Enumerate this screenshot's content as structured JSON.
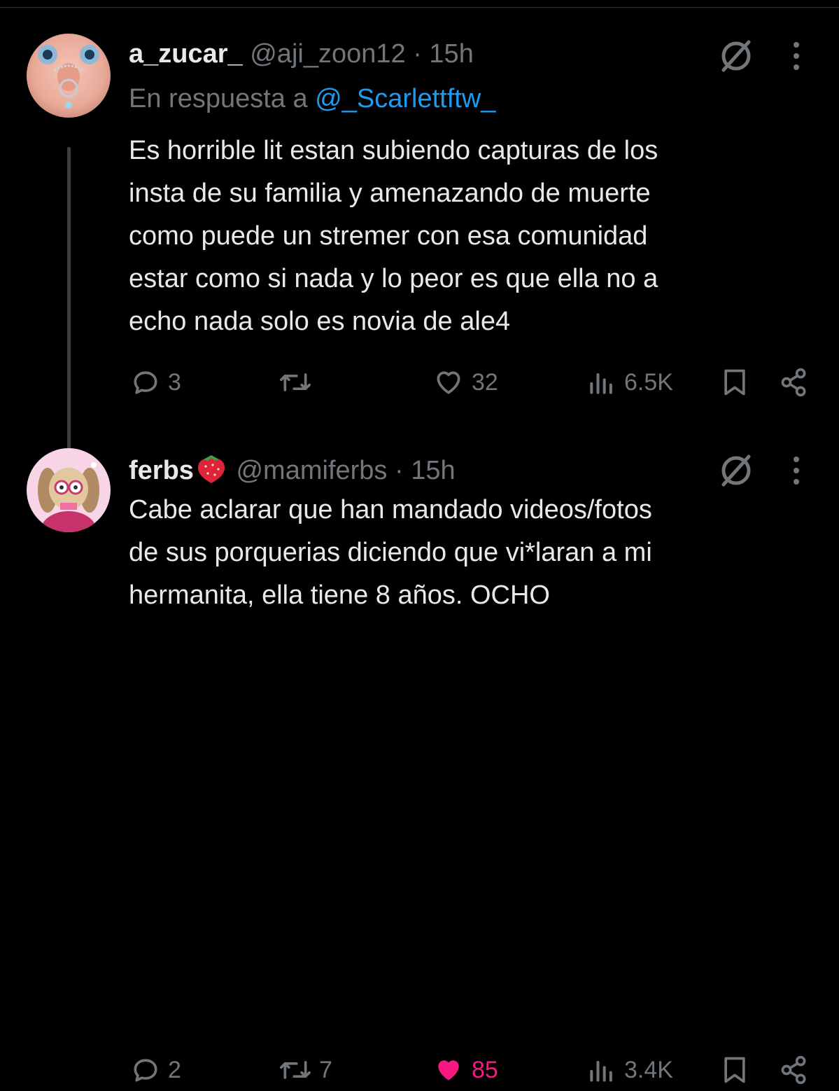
{
  "tweets": [
    {
      "author_name": "a_zucar_",
      "handle": "@aji_zoon12",
      "separator": "·",
      "time": "15h",
      "reply_prefix": "En respuesta a",
      "reply_mention": "@_Scarlettftw_",
      "text": "Es horrible lit estan subiendo capturas de los\ninsta de su familia y amenazando de muerte\ncomo puede un stremer con esa comunidad\nestar como si nada y lo peor es que ella no a\necho nada solo es novia de ale4",
      "replies": "3",
      "retweets": "",
      "likes": "32",
      "liked": false,
      "views": "6.5K"
    },
    {
      "author_name": "ferbs",
      "handle": "@mamiferbs",
      "separator": "·",
      "time": "15h",
      "text": "Cabe aclarar que han mandado videos/fotos\nde sus porquerias diciendo que vi*laran a mi\nhermanita, ella tiene 8 años. OCHO",
      "replies": "2",
      "retweets": "7",
      "likes": "85",
      "liked": true,
      "views": "3.4K"
    }
  ],
  "colors": {
    "background": "#000000",
    "text": "#e7e9ea",
    "muted": "#71767b",
    "link": "#1d9bf0",
    "like": "#f91880"
  },
  "icons": [
    "reply-icon",
    "retweet-icon",
    "heart-icon",
    "views-icon",
    "bookmark-icon",
    "share-icon",
    "grok-icon",
    "more-icon",
    "strawberry-icon"
  ]
}
